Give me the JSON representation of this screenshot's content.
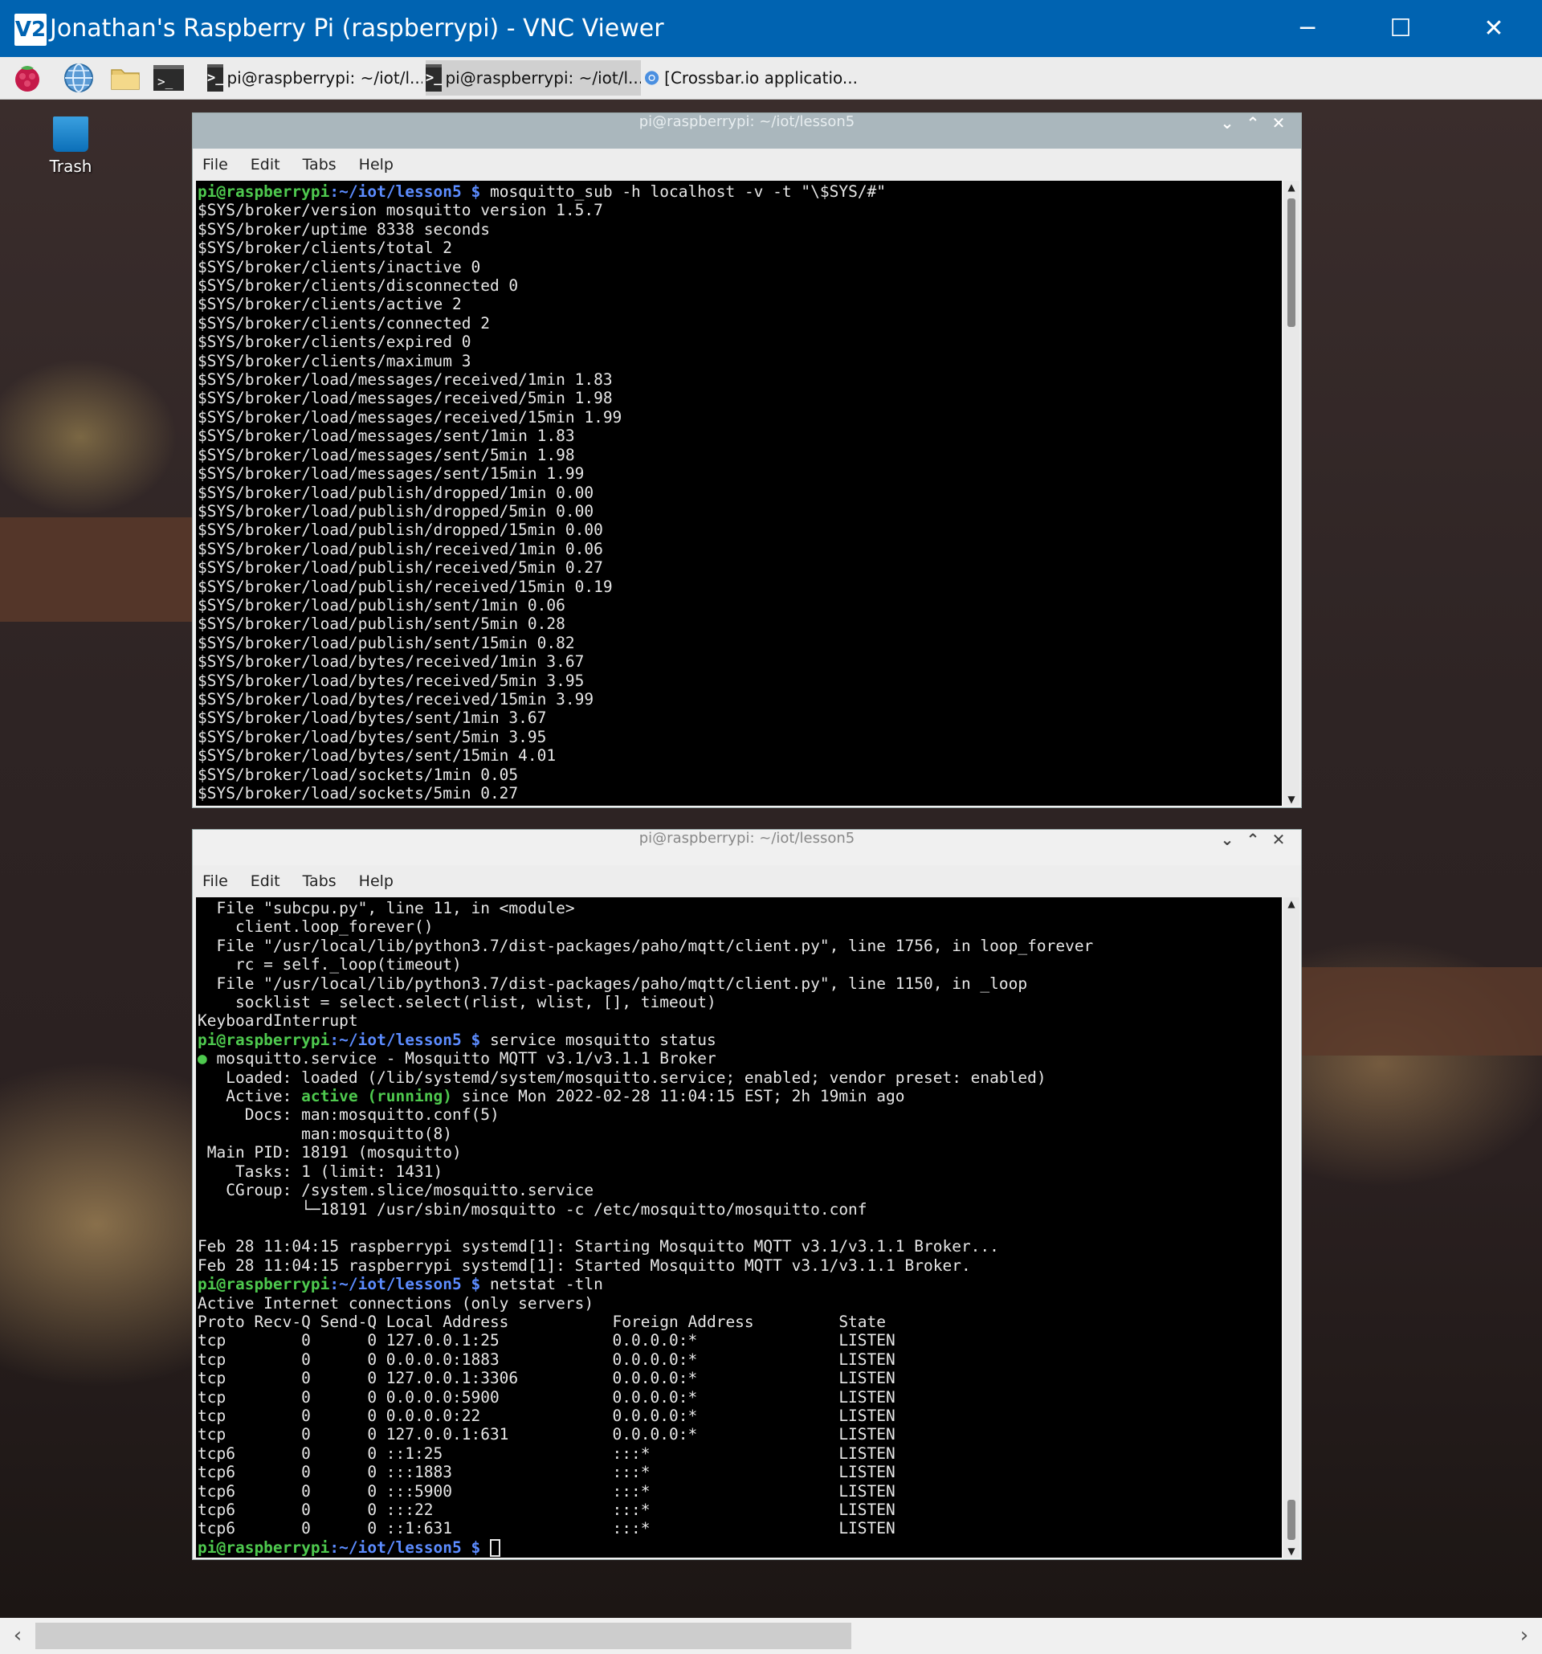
{
  "vnc_window": {
    "logo_text": "V2",
    "title": "Jonathan's Raspberry Pi (raspberrypi) - VNC Viewer",
    "minimize": "─",
    "maximize": "☐",
    "close": "✕"
  },
  "taskbar": {
    "launchers": [
      {
        "name": "raspberry-menu-icon"
      },
      {
        "name": "browser-globe-icon"
      },
      {
        "name": "file-manager-folder-icon"
      },
      {
        "name": "terminal-launcher-icon"
      }
    ],
    "tasks": [
      {
        "label": "pi@raspberrypi: ~/iot/l...",
        "active": false
      },
      {
        "label": "pi@raspberrypi: ~/iot/l...",
        "active": true
      },
      {
        "label": "[Crossbar.io applicatio...",
        "active": false
      }
    ],
    "terminal_glyph": ">_"
  },
  "desktop": {
    "trash_label": "Trash"
  },
  "terminal_top": {
    "title": "pi@raspberrypi: ~/iot/lesson5",
    "menu": [
      "File",
      "Edit",
      "Tabs",
      "Help"
    ],
    "prompt_user": "pi@raspberrypi",
    "prompt_path": ":~/iot/lesson5 $",
    "command": " mosquitto_sub -h localhost -v -t \"\\$SYS/#\"",
    "output": [
      "$SYS/broker/version mosquitto version 1.5.7",
      "$SYS/broker/uptime 8338 seconds",
      "$SYS/broker/clients/total 2",
      "$SYS/broker/clients/inactive 0",
      "$SYS/broker/clients/disconnected 0",
      "$SYS/broker/clients/active 2",
      "$SYS/broker/clients/connected 2",
      "$SYS/broker/clients/expired 0",
      "$SYS/broker/clients/maximum 3",
      "$SYS/broker/load/messages/received/1min 1.83",
      "$SYS/broker/load/messages/received/5min 1.98",
      "$SYS/broker/load/messages/received/15min 1.99",
      "$SYS/broker/load/messages/sent/1min 1.83",
      "$SYS/broker/load/messages/sent/5min 1.98",
      "$SYS/broker/load/messages/sent/15min 1.99",
      "$SYS/broker/load/publish/dropped/1min 0.00",
      "$SYS/broker/load/publish/dropped/5min 0.00",
      "$SYS/broker/load/publish/dropped/15min 0.00",
      "$SYS/broker/load/publish/received/1min 0.06",
      "$SYS/broker/load/publish/received/5min 0.27",
      "$SYS/broker/load/publish/received/15min 0.19",
      "$SYS/broker/load/publish/sent/1min 0.06",
      "$SYS/broker/load/publish/sent/5min 0.28",
      "$SYS/broker/load/publish/sent/15min 0.82",
      "$SYS/broker/load/bytes/received/1min 3.67",
      "$SYS/broker/load/bytes/received/5min 3.95",
      "$SYS/broker/load/bytes/received/15min 3.99",
      "$SYS/broker/load/bytes/sent/1min 3.67",
      "$SYS/broker/load/bytes/sent/5min 3.95",
      "$SYS/broker/load/bytes/sent/15min 4.01",
      "$SYS/broker/load/sockets/1min 0.05",
      "$SYS/broker/load/sockets/5min 0.27"
    ]
  },
  "terminal_bottom": {
    "title": "pi@raspberrypi: ~/iot/lesson5",
    "menu": [
      "File",
      "Edit",
      "Tabs",
      "Help"
    ],
    "lines": [
      {
        "t": "  File \"subcpu.py\", line 11, in <module>"
      },
      {
        "t": "    client.loop_forever()"
      },
      {
        "t": "  File \"/usr/local/lib/python3.7/dist-packages/paho/mqtt/client.py\", line 1756, in loop_forever"
      },
      {
        "t": "    rc = self._loop(timeout)"
      },
      {
        "t": "  File \"/usr/local/lib/python3.7/dist-packages/paho/mqtt/client.py\", line 1150, in _loop"
      },
      {
        "t": "    socklist = select.select(rlist, wlist, [], timeout)"
      },
      {
        "t": "KeyboardInterrupt"
      },
      {
        "prompt": true,
        "t": " service mosquitto status"
      },
      {
        "dot": "●",
        "t": " mosquitto.service - Mosquitto MQTT v3.1/v3.1.1 Broker"
      },
      {
        "t": "   Loaded: loaded (/lib/systemd/system/mosquitto.service; enabled; vendor preset: enabled)"
      },
      {
        "t": "   Active: ",
        "green": "active (running)",
        "rest": " since Mon 2022-02-28 11:04:15 EST; 2h 19min ago"
      },
      {
        "t": "     Docs: man:mosquitto.conf(5)"
      },
      {
        "t": "           man:mosquitto(8)"
      },
      {
        "t": " Main PID: 18191 (mosquitto)"
      },
      {
        "t": "    Tasks: 1 (limit: 1431)"
      },
      {
        "t": "   CGroup: /system.slice/mosquitto.service"
      },
      {
        "t": "           └─18191 /usr/sbin/mosquitto -c /etc/mosquitto/mosquitto.conf"
      },
      {
        "t": ""
      },
      {
        "t": "Feb 28 11:04:15 raspberrypi systemd[1]: Starting Mosquitto MQTT v3.1/v3.1.1 Broker..."
      },
      {
        "t": "Feb 28 11:04:15 raspberrypi systemd[1]: Started Mosquitto MQTT v3.1/v3.1.1 Broker."
      },
      {
        "prompt": true,
        "t": " netstat -tln"
      },
      {
        "t": "Active Internet connections (only servers)"
      },
      {
        "t": "Proto Recv-Q Send-Q Local Address           Foreign Address         State"
      },
      {
        "t": "tcp        0      0 127.0.0.1:25            0.0.0.0:*               LISTEN"
      },
      {
        "t": "tcp        0      0 0.0.0.0:1883            0.0.0.0:*               LISTEN"
      },
      {
        "t": "tcp        0      0 127.0.0.1:3306          0.0.0.0:*               LISTEN"
      },
      {
        "t": "tcp        0      0 0.0.0.0:5900            0.0.0.0:*               LISTEN"
      },
      {
        "t": "tcp        0      0 0.0.0.0:22              0.0.0.0:*               LISTEN"
      },
      {
        "t": "tcp        0      0 127.0.0.1:631           0.0.0.0:*               LISTEN"
      },
      {
        "t": "tcp6       0      0 ::1:25                  :::*                    LISTEN"
      },
      {
        "t": "tcp6       0      0 :::1883                 :::*                    LISTEN"
      },
      {
        "t": "tcp6       0      0 :::5900                 :::*                    LISTEN"
      },
      {
        "t": "tcp6       0      0 :::22                   :::*                    LISTEN"
      },
      {
        "t": "tcp6       0      0 ::1:631                 :::*                    LISTEN"
      },
      {
        "prompt": true,
        "t": " ",
        "cursor": true
      }
    ],
    "prompt_user": "pi@raspberrypi",
    "prompt_path": ":~/iot/lesson5 $"
  },
  "window_controls": {
    "minimize": "⌄",
    "maximize": "⌃",
    "close": "✕"
  },
  "scrollbar": {
    "left_arrow": "‹",
    "right_arrow": "›"
  }
}
